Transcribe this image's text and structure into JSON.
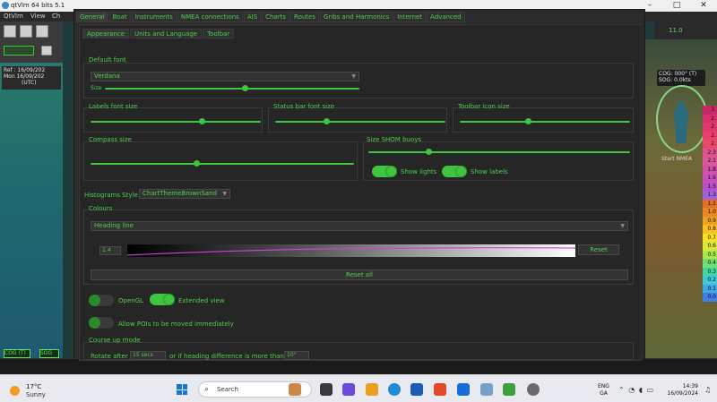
{
  "background_app": {
    "title": "qtVlm 64 bits 5.1",
    "menu": [
      "QtVlm",
      "View",
      "Ch"
    ],
    "info_ref": "Ref : 16/09/202",
    "info_mon": "Mon 16/09/202",
    "info_utc": "(UTC)",
    "speed_value": "11.0",
    "right_info_cog": "COG: 000° (T)",
    "right_info_sog": "SOG: 0.0kts",
    "start_nmea": "Start NMEA",
    "cog_label": "COG (T)",
    "sog_label": "SOG",
    "window_controls": [
      "–",
      "□",
      "✕"
    ],
    "scale_values": [
      "3.",
      "2.",
      "2.",
      "2.",
      "2.",
      "2.3",
      "2.1",
      "1.8",
      "1.6",
      "1.5",
      "1.3",
      "1.1",
      "1.0",
      "0.9",
      "0.8",
      "0.7",
      "0.6",
      "0.5",
      "0.4",
      "0.3",
      "0.2",
      "0.1",
      "0.0"
    ]
  },
  "dialog": {
    "tabs": [
      "General",
      "Boat",
      "Instruments",
      "NMEA connections",
      "AIS",
      "Charts",
      "Routes",
      "Gribs and Harmonics",
      "Internet",
      "Advanced"
    ],
    "active_tab": 0,
    "subtabs": [
      "Appearance",
      "Units and Language",
      "Toolbar"
    ],
    "active_subtab": 0,
    "default_font": {
      "label": "Default font",
      "value": "Verdana",
      "size_label": "Size",
      "size_level": 0.55
    },
    "labels_font_size": {
      "label": "Labels font size",
      "level": 0.65
    },
    "status_bar_font_size": {
      "label": "Status bar font size",
      "level": 0.3
    },
    "toolbar_icon_size": {
      "label": "Toolbar icon size",
      "level": 0.4
    },
    "compass_size": {
      "label": "Compass size",
      "level": 0.4
    },
    "size_shom_buoys": {
      "label": "Size SHOM buoys",
      "level": 0.23,
      "show_lights": "Show lights",
      "show_labels": "Show labels"
    },
    "histograms_style": {
      "label": "Histograms Style",
      "value": "ChartThemeBrownSand"
    },
    "colours": {
      "label": "Colours",
      "selected": "Heading line",
      "width_value": "1.4",
      "reset_label": "Reset",
      "reset_all_label": "Reset all"
    },
    "opengl_label": "OpenGL",
    "extended_view_label": "Extended view",
    "allow_pois_label": "Allow POIs to be moved immediately",
    "course_up": {
      "label": "Course up mode",
      "rotate_after": "Rotate after",
      "secs_value": "15 secs",
      "or_if": "or if heading difference is more than",
      "deg_value": "10°"
    }
  },
  "taskbar": {
    "weather_temp": "17°C",
    "weather_cond": "Sunny",
    "search_placeholder": "Search",
    "lang_top": "ENG",
    "lang_bottom": "GA",
    "time": "14:39",
    "date": "16/09/2024",
    "colors": {
      "accent_green": "#3fc53f",
      "dialog_bg": "#2b2b2b",
      "taskbar_bg": "#e9eaf0"
    }
  }
}
